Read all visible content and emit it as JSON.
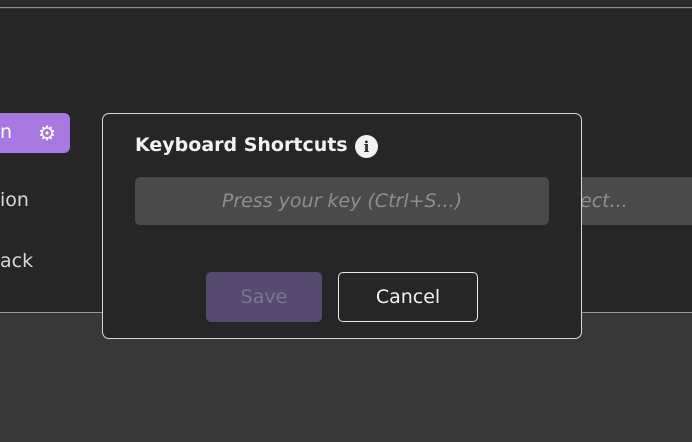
{
  "background": {
    "pill_label": "n",
    "pill_icon": "gear-icon",
    "item_1": "ion",
    "item_2": "ack",
    "select_placeholder": "ect..."
  },
  "modal": {
    "title": "Keyboard Shortcuts",
    "info_icon": "info-icon",
    "info_glyph": "i",
    "input_placeholder": "Press your key (Ctrl+S...)",
    "save_label": "Save",
    "cancel_label": "Cancel"
  },
  "colors": {
    "accent": "#a678e0",
    "save_disabled_bg": "#574a70",
    "panel_bg": "#262626",
    "input_bg": "#4a4a4a"
  }
}
